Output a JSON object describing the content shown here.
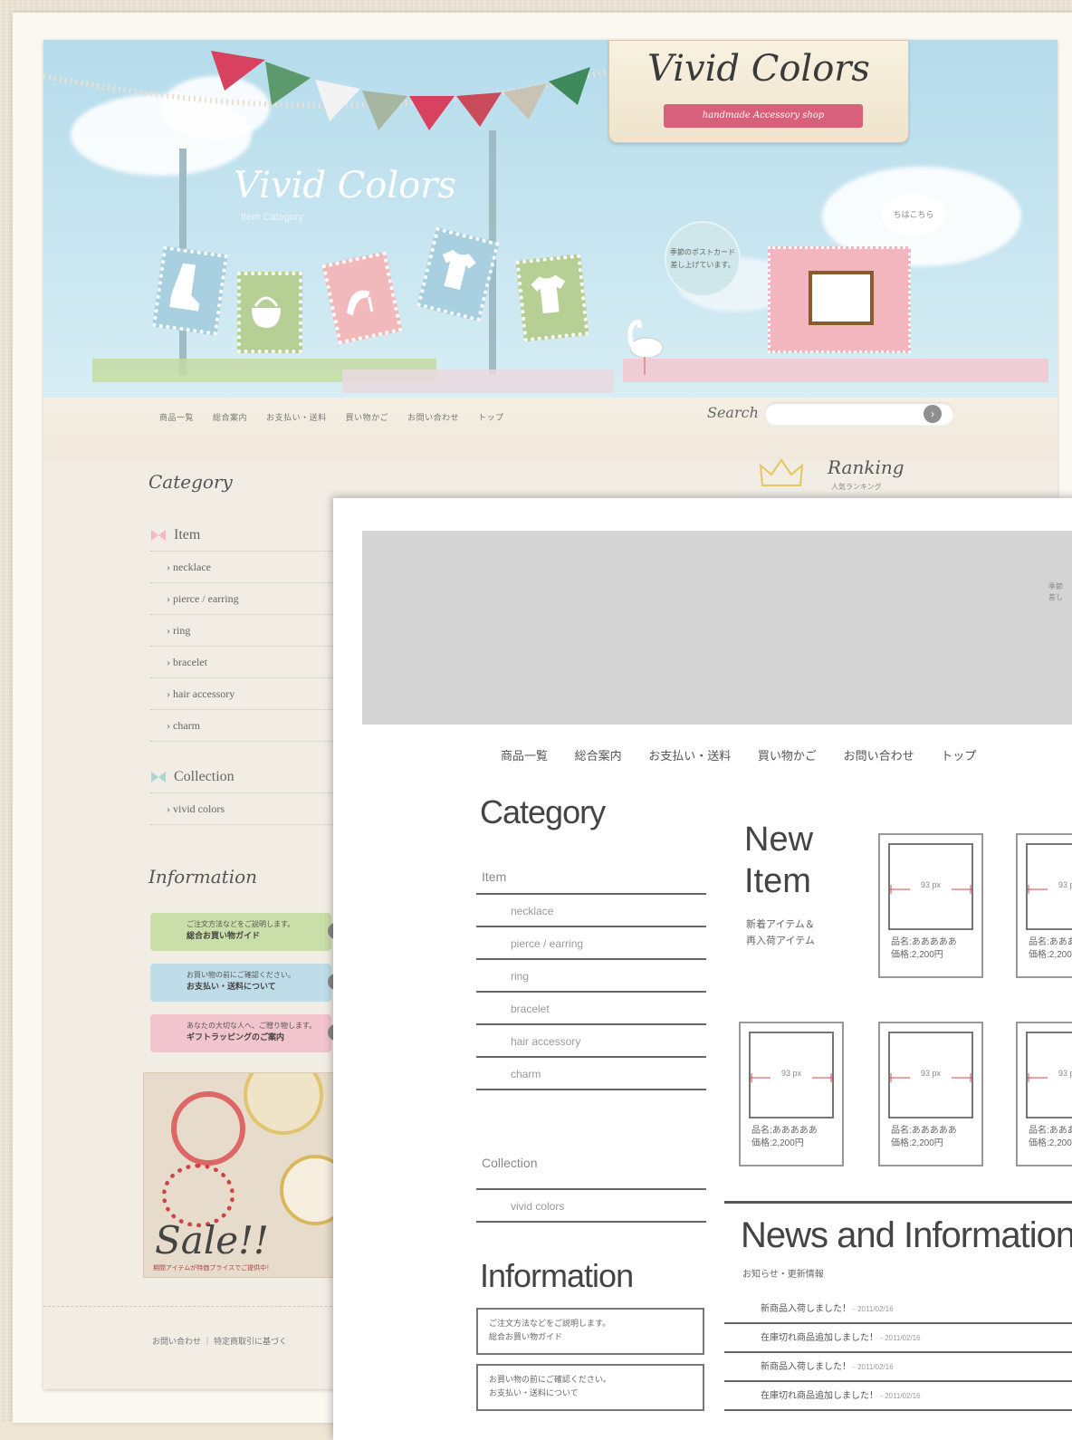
{
  "back_design": {
    "logo_title": "Vivid Colors",
    "logo_ribbon": "handmade Accessory shop",
    "sky_title": "Vivid Colors",
    "sky_subtitle": "Item Category",
    "bubble_text": "季節のポストカード<br>差し上げています。",
    "bubble2_text": "ちはこちら",
    "nav": [
      "商品一覧",
      "総合案内",
      "お支払い・送料",
      "買い物かご",
      "お問い合わせ",
      "トップ"
    ],
    "search_label": "Search",
    "ranking_title": "Ranking",
    "ranking_sub": "人気ランキング",
    "category_title": "Category",
    "item_group": "Item",
    "items": [
      "necklace",
      "pierce / earring",
      "ring",
      "bracelet",
      "hair accessory",
      "charm"
    ],
    "collection_group": "Collection",
    "collections": [
      "vivid colors"
    ],
    "information_title": "Information",
    "info_bars": [
      {
        "line1": "ご注文方法などをご説明します。",
        "line2": "総合お買い物ガイド",
        "color": "#c9dea9"
      },
      {
        "line1": "お買い物の前にご確認ください。",
        "line2": "お支払い・送料について",
        "color": "#bfdde9"
      },
      {
        "line1": "あなたの大切な人へ、ご贈り物します。",
        "line2": "ギフトラッピングのご案内",
        "color": "#f2c4cd"
      }
    ],
    "sale_text": "Sale!!",
    "sale_sub": "期間アイテムが特価プライスでご提供中！",
    "footer": "お問い合わせ ｜ 特定商取引に基づく"
  },
  "wireframe": {
    "corner_text": [
      "季節",
      "差し"
    ],
    "nav": [
      "商品一覧",
      "総合案内",
      "お支払い・送料",
      "買い物かご",
      "お問い合わせ",
      "トップ"
    ],
    "category_title": "Category",
    "item_group": "Item",
    "items": [
      "necklace",
      "pierce / earring",
      "ring",
      "bracelet",
      "hair accessory",
      "charm"
    ],
    "collection_group": "Collection",
    "collections": [
      "vivid colors"
    ],
    "information_title": "Information",
    "info_boxes": [
      {
        "line1": "ご注文方法などをご説明します。",
        "line2": "総合お買い物ガイド"
      },
      {
        "line1": "お買い物の前にご確認ください。",
        "line2": "お支払い・送料について"
      }
    ],
    "new_title_1": "New",
    "new_title_2": "Item",
    "new_sub_1": "新着アイテム＆",
    "new_sub_2": "再入荷アイテム",
    "product_px": "93 px",
    "product_name": "品名:あああああ",
    "product_price": "価格:2,200円",
    "news_title": "News and Information",
    "news_sub": "お知らせ・更新情報",
    "news": [
      {
        "text": "新商品入荷しました！",
        "date": " - 2011/02/16"
      },
      {
        "text": "在庫切れ商品追加しました！",
        "date": " - 2011/02/16"
      },
      {
        "text": "新商品入荷しました！",
        "date": " - 2011/02/16"
      },
      {
        "text": "在庫切れ商品追加しました！",
        "date": " - 2011/02/16"
      }
    ]
  }
}
